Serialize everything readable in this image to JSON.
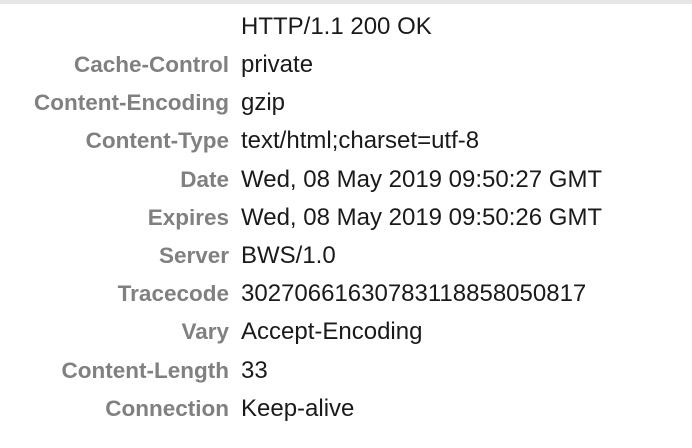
{
  "response": {
    "status_line": "HTTP/1.1 200 OK",
    "headers": [
      {
        "name": "Cache-Control",
        "value": "private"
      },
      {
        "name": "Content-Encoding",
        "value": "gzip"
      },
      {
        "name": "Content-Type",
        "value": "text/html;charset=utf-8"
      },
      {
        "name": "Date",
        "value": "Wed, 08 May 2019 09:50:27 GMT"
      },
      {
        "name": "Expires",
        "value": "Wed, 08 May 2019 09:50:26 GMT"
      },
      {
        "name": "Server",
        "value": "BWS/1.0"
      },
      {
        "name": "Tracecode",
        "value": "30270661630783118858050817"
      },
      {
        "name": "Vary",
        "value": "Accept-Encoding"
      },
      {
        "name": "Content-Length",
        "value": "33"
      },
      {
        "name": "Connection",
        "value": "Keep-alive"
      }
    ]
  },
  "colors": {
    "header_name": "#808080",
    "header_value": "#1a1a1a",
    "background": "#ffffff"
  }
}
